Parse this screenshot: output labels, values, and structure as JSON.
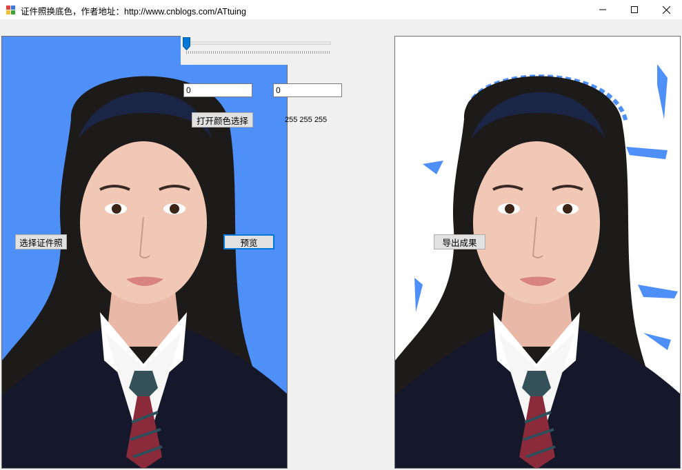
{
  "window": {
    "title": "证件照换底色，作者地址：http://www.cnblogs.com/ATtuing",
    "icon": "app-icon",
    "controls": [
      "minimize-icon",
      "maximize-icon",
      "close-icon"
    ]
  },
  "controls": {
    "slider_value": 0,
    "textbox1_value": "0",
    "textbox2_value": "0",
    "color_button_label": "打开颜色选择",
    "rgb_label": "255  255  255",
    "select_photo_label": "选择证件照",
    "preview_label": "预览",
    "export_label": "导出成果"
  },
  "images": {
    "source_bg_color": "#4f8ff8",
    "result_bg_color": "#ffffff"
  }
}
